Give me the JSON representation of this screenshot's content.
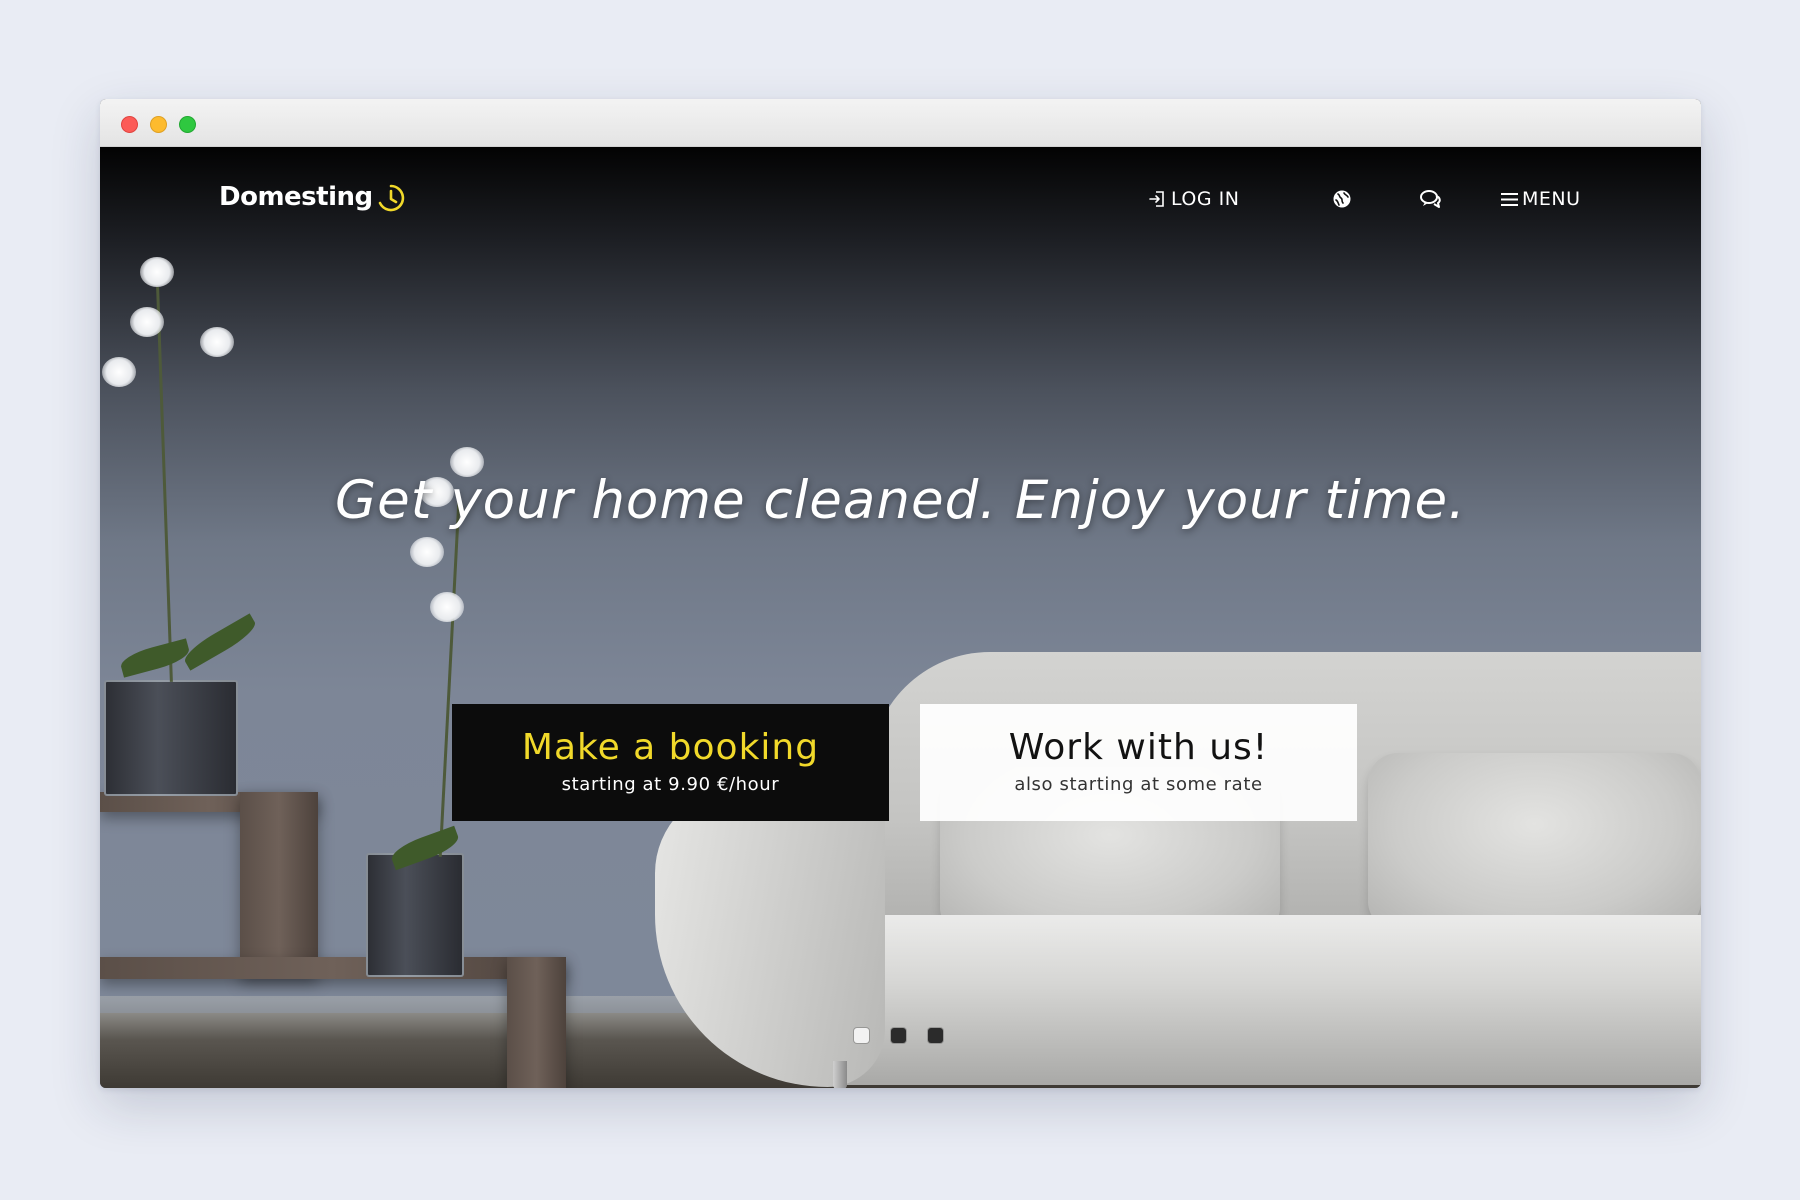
{
  "window": {
    "controls": [
      "close",
      "minimize",
      "maximize"
    ]
  },
  "brand": {
    "name": "Domesting",
    "icon": "clock-icon",
    "accent_color": "#f1d92a"
  },
  "nav": {
    "login_label": "LOG IN",
    "login_icon": "login-icon",
    "language_icon": "globe-icon",
    "chat_icon": "chat-bubbles-icon",
    "menu_label": "MENU",
    "menu_icon": "hamburger-icon"
  },
  "hero": {
    "headline": "Get your home cleaned. Enjoy your time.",
    "booking": {
      "title": "Make a booking",
      "subtitle": "starting at 9.90 €/hour"
    },
    "work": {
      "title": "Work with us!",
      "subtitle": "also starting at some rate"
    }
  },
  "carousel": {
    "slide_count": 3,
    "active_index": 0
  }
}
